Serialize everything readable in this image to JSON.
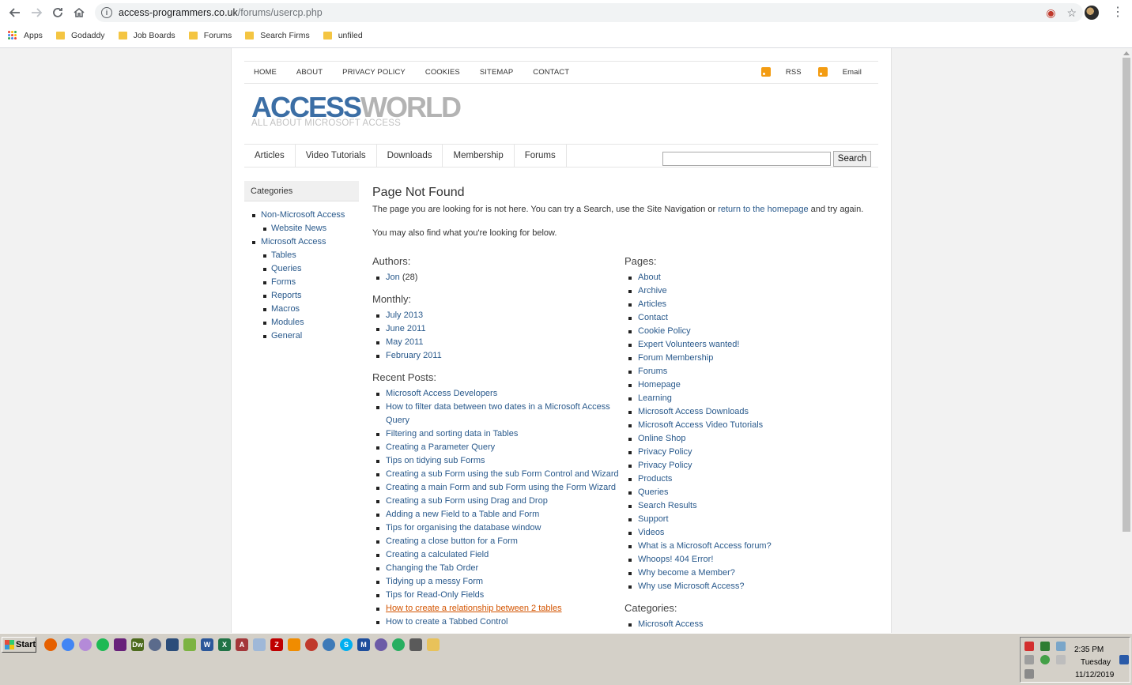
{
  "browser": {
    "url_host": "access-programmers.co.uk",
    "url_path": "/forums/usercp.php",
    "bookmarks": [
      "Apps",
      "Godaddy",
      "Job Boards",
      "Forums",
      "Search Firms",
      "unfiled"
    ]
  },
  "site": {
    "topnav": [
      "HOME",
      "ABOUT",
      "PRIVACY POLICY",
      "COOKIES",
      "SITEMAP",
      "CONTACT"
    ],
    "feeds": {
      "rss": "RSS",
      "email": "Email"
    },
    "logo": {
      "part1": "ACCESS",
      "part2": "WORLD",
      "tagline": "ALL ABOUT MICROSOFT ACCESS"
    },
    "mainnav": [
      "Articles",
      "Video Tutorials",
      "Downloads",
      "Membership",
      "Forums"
    ],
    "search": {
      "button": "Search",
      "value": ""
    }
  },
  "sidebar": {
    "title": "Categories",
    "items": [
      {
        "label": "Non-Microsoft Access",
        "level": 0
      },
      {
        "label": "Website News",
        "level": 1
      },
      {
        "label": "Microsoft Access",
        "level": 0
      },
      {
        "label": "Tables",
        "level": 1
      },
      {
        "label": "Queries",
        "level": 1
      },
      {
        "label": "Forms",
        "level": 1
      },
      {
        "label": "Reports",
        "level": 1
      },
      {
        "label": "Macros",
        "level": 1
      },
      {
        "label": "Modules",
        "level": 1
      },
      {
        "label": "General",
        "level": 1
      }
    ]
  },
  "content": {
    "title": "Page Not Found",
    "intro_before": "The page you are looking for is not here.  You can try a Search, use the Site Navigation or ",
    "intro_link": "return to the homepage",
    "intro_after": " and try again.",
    "also": "You may also find what you're looking for below.",
    "authors_heading": "Authors:",
    "authors": [
      {
        "name": "Jon",
        "count": "(28)"
      }
    ],
    "monthly_heading": "Monthly:",
    "monthly": [
      "July 2013",
      "June 2011",
      "May 2011",
      "February 2011"
    ],
    "recent_heading": "Recent Posts:",
    "recent": [
      "Microsoft Access Developers",
      "How to filter data between two dates in a Microsoft Access Query",
      "Filtering and sorting data in Tables",
      "Creating a Parameter Query",
      "Tips on tidying sub Forms",
      "Creating a sub Form using the sub Form Control and Wizard",
      "Creating a main Form and sub Form using the Form Wizard",
      "Creating a sub Form using Drag and Drop",
      "Adding a new Field to a Table and Form",
      "Tips for organising the database window",
      "Creating a close button for a Form",
      "Creating a calculated Field",
      "Changing the Tab Order",
      "Tidying up a messy Form",
      "Tips for Read-Only Fields",
      "How to create a relationship between 2 tables",
      "How to create a Tabbed Control"
    ],
    "pages_heading": "Pages:",
    "pages": [
      "About",
      "Archive",
      "Articles",
      "Contact",
      "Cookie Policy",
      "Expert Volunteers wanted!",
      "Forum Membership",
      "Forums",
      "Homepage",
      "Learning",
      "Microsoft Access Downloads",
      "Microsoft Access Video Tutorials",
      "Online Shop",
      "Privacy Policy",
      "Privacy Policy",
      "Products",
      "Queries",
      "Search Results",
      "Support",
      "Videos",
      "What is a Microsoft Access forum?",
      "Whoops! 404 Error!",
      "Why become a Member?",
      "Why use Microsoft Access?"
    ],
    "categories_heading": "Categories:",
    "categories": [
      "Microsoft Access"
    ]
  },
  "taskbar": {
    "start": "Start",
    "time": "2:35 PM",
    "day": "Tuesday",
    "date": "11/12/2019"
  },
  "colors": {
    "link": "#2a5a8c",
    "hover_link": "#d35400",
    "logo_blue": "#3b6ea5",
    "logo_gray": "#b3b3b3"
  }
}
